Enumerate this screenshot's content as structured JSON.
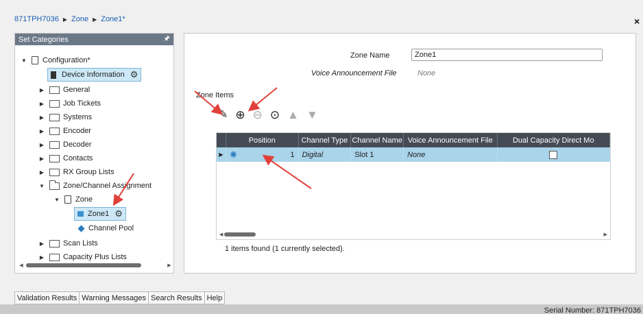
{
  "breadcrumb": {
    "items": [
      "871TPH7036",
      "Zone",
      "Zone1*"
    ],
    "separator": "▶"
  },
  "close_glyph": "×",
  "left_panel": {
    "header": "Set Categories",
    "pin_glyph": "🖈",
    "tree": {
      "configuration": "Configuration*",
      "device_information": "Device Information",
      "general": "General",
      "job_tickets": "Job Tickets",
      "systems": "Systems",
      "encoder": "Encoder",
      "decoder": "Decoder",
      "contacts": "Contacts",
      "rx_group_lists": "RX Group Lists",
      "zone_channel_assignment": "Zone/Channel Assignment",
      "zone": "Zone",
      "zone1": "Zone1",
      "channel_pool": "Channel Pool",
      "scan_lists": "Scan Lists",
      "capacity_plus_lists": "Capacity Plus Lists"
    }
  },
  "right_panel": {
    "zone_name_label": "Zone Name",
    "zone_name_value": "Zone1",
    "voice_label": "Voice Announcement File",
    "voice_value": "None",
    "zone_items_label": "Zone Items",
    "grid": {
      "columns": [
        "Position",
        "Channel Type",
        "Channel Name",
        "Voice Announcement File",
        "Dual Capacity Direct Mo"
      ],
      "rows": [
        {
          "position": "1",
          "channel_type": "Digital",
          "channel_name": "Slot 1",
          "voice_file": "None",
          "dual_capacity": false
        }
      ]
    },
    "found_text": "1 items found (1 currently selected)."
  },
  "bottom_tabs": [
    "Validation Results",
    "Warning Messages",
    "Search Results",
    "Help"
  ],
  "status": {
    "serial": "Serial Number: 871TPH7036"
  },
  "colors": {
    "accent_blue": "#1a5fb4",
    "selection": "#a9d4ea",
    "header_dark": "#444b55",
    "arrow_red": "#e0413a"
  }
}
